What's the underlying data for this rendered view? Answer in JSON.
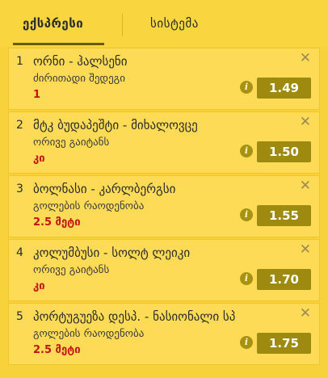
{
  "tabs": {
    "express": "ექსპრესი",
    "system": "სისტემა"
  },
  "close_symbol": "✕",
  "info_symbol": "i",
  "bets": [
    {
      "num": "1",
      "title": "ორნი - ჰალსენი",
      "market": "ძირითადი შედეგი",
      "pick": "1",
      "odds": "1.49"
    },
    {
      "num": "2",
      "title": "მტკ ბუდაპეშტი - მიხალოვცე",
      "market": "ორივე გაიტანს",
      "pick": "კი",
      "odds": "1.50"
    },
    {
      "num": "3",
      "title": "ბოლნასი - კარლბერგსი",
      "market": "გოლების რაოდენობა",
      "pick": "2.5 მეტი",
      "odds": "1.55"
    },
    {
      "num": "4",
      "title": "კოლუმბუსი - სოლტ ლეიკი",
      "market": "ორივე გაიტანს",
      "pick": "კი",
      "odds": "1.70"
    },
    {
      "num": "5",
      "title": "პორტუგუეზა დესპ. - ნასიონალი სპ",
      "market": "გოლების რაოდენობა",
      "pick": "2.5 მეტი",
      "odds": "1.75"
    }
  ],
  "colors": {
    "background": "#f8d23a",
    "card": "#fddb57",
    "odds_button": "#9d8a0e",
    "pick_text": "#c41414"
  }
}
